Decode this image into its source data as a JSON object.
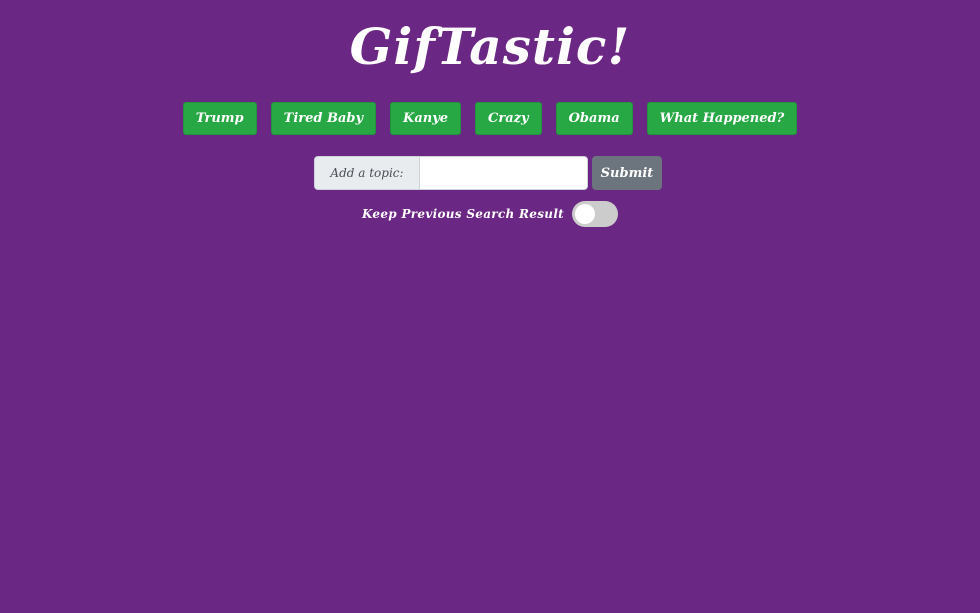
{
  "title": "GifTastic!",
  "topics": [
    "Trump",
    "Tired Baby",
    "Kanye",
    "Crazy",
    "Obama",
    "What Happened?"
  ],
  "form": {
    "label": "Add a topic:",
    "input_value": "",
    "placeholder": "",
    "submit_label": "Submit"
  },
  "keep_previous": {
    "label": "Keep Previous Search Result",
    "enabled": false
  },
  "colors": {
    "background": "#6b2784",
    "topic_button": "#28a745",
    "submit_button": "#6c757d",
    "toggle_off": "#cccccc"
  }
}
